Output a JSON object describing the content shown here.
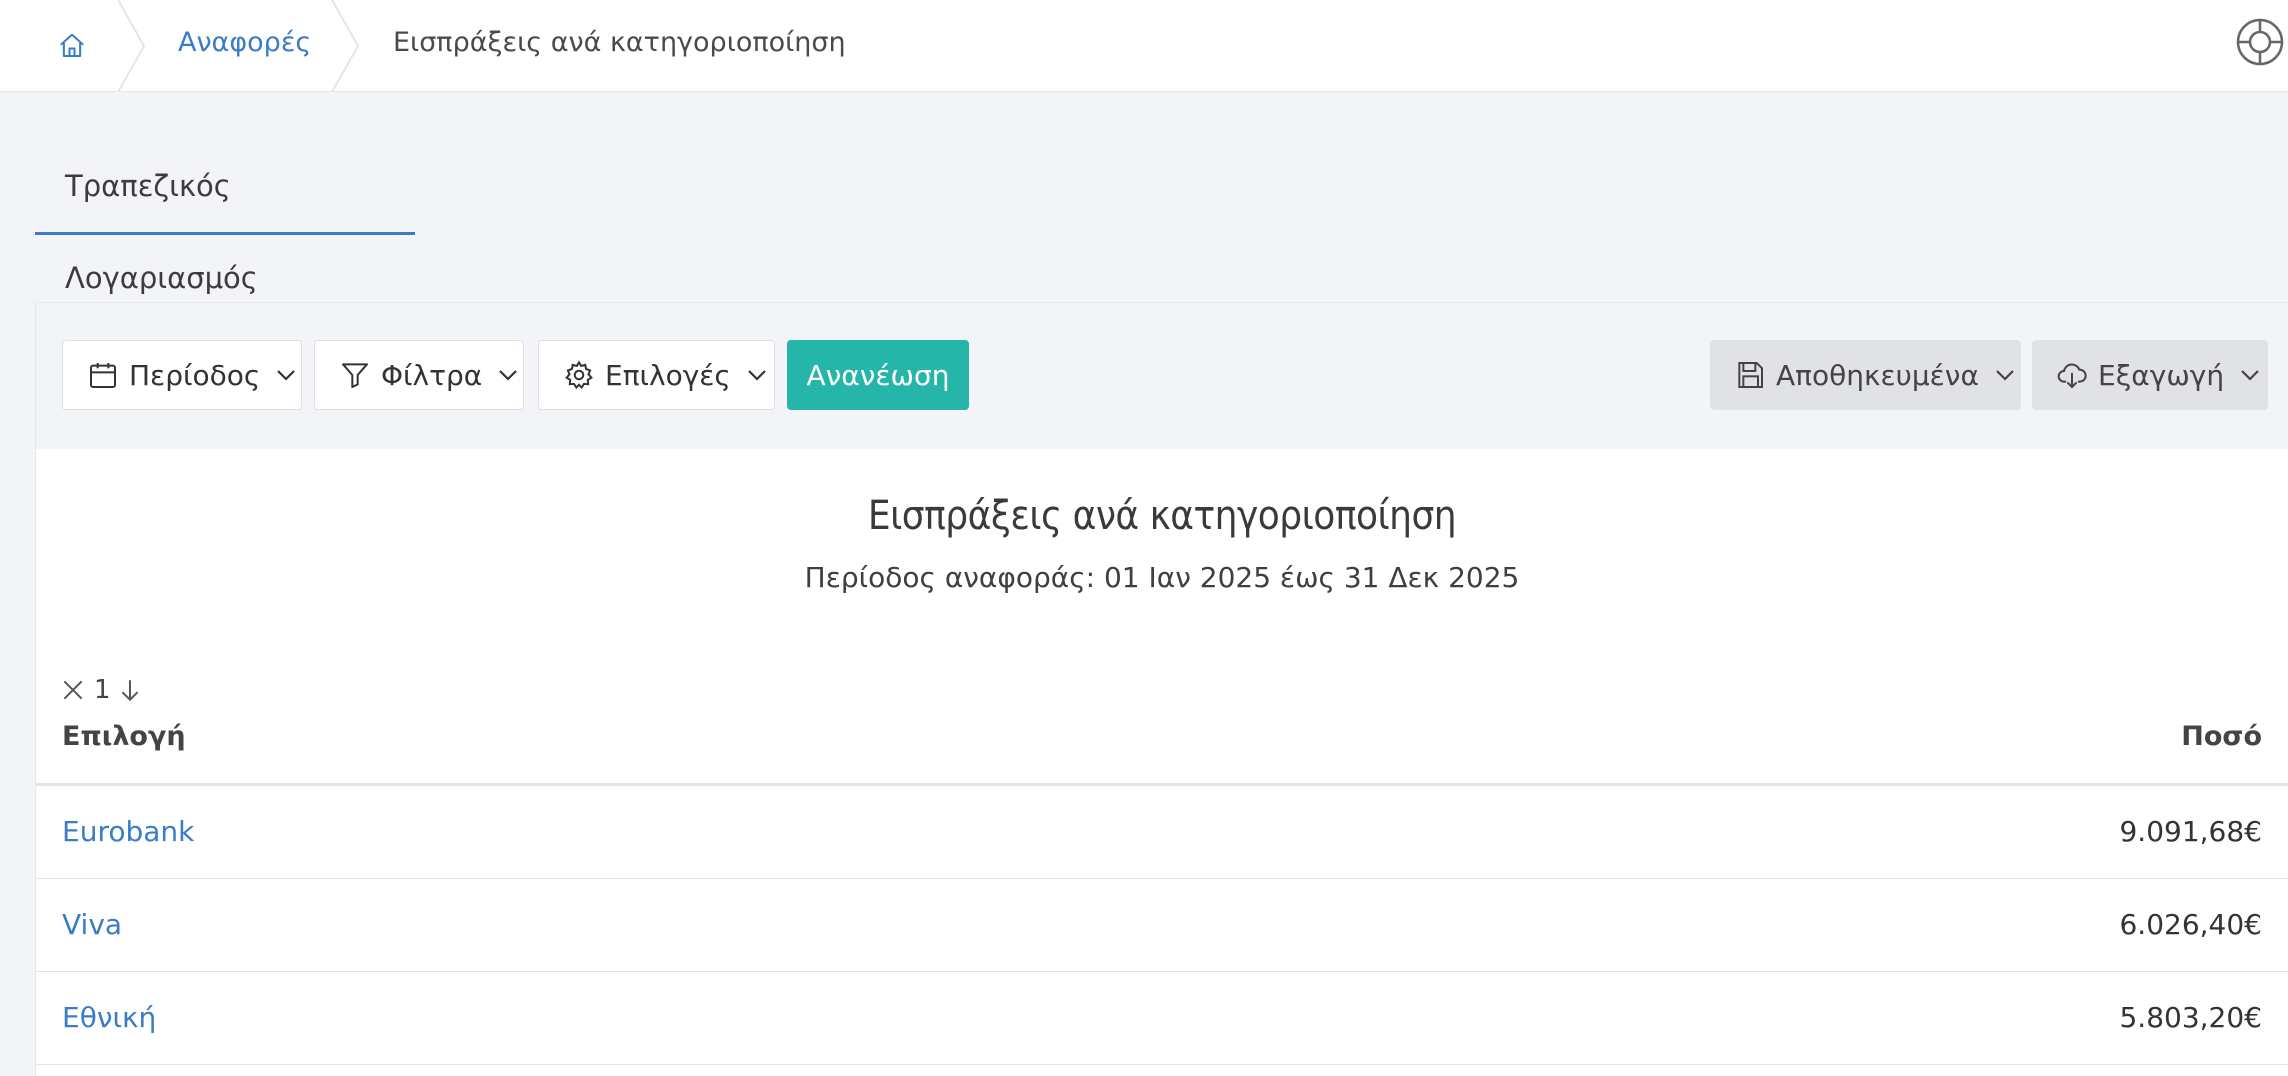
{
  "breadcrumb": {
    "home_icon": "home-icon",
    "items": [
      "Αναφορές"
    ],
    "current": "Εισπράξεις ανά κατηγοριοποίηση"
  },
  "help_icon": "lifebuoy-icon",
  "tabs": [
    {
      "label": "Τραπεζικός Λογαριασμός",
      "active": true
    }
  ],
  "toolbar": {
    "period_label": "Περίοδος",
    "filters_label": "Φίλτρα",
    "options_label": "Επιλογές",
    "refresh_label": "Ανανέωση",
    "saved_label": "Αποθηκευμένα",
    "export_label": "Εξαγωγή"
  },
  "report": {
    "title": "Εισπράξεις ανά κατηγοριοποίηση",
    "period": "Περίοδος αναφοράς: 01 Ιαν 2025 έως 31 Δεκ 2025",
    "sort_level": "1",
    "columns": {
      "selection": "Επιλογή",
      "amount": "Ποσό"
    },
    "rows": [
      {
        "name": "Eurobank",
        "amount": "9.091,68€"
      },
      {
        "name": "Viva",
        "amount": "6.026,40€"
      },
      {
        "name": "Εθνική",
        "amount": "5.803,20€"
      }
    ]
  },
  "colors": {
    "accent": "#3a7dc6",
    "primary_button": "#26b5a9",
    "background": "#f3f4f7"
  }
}
